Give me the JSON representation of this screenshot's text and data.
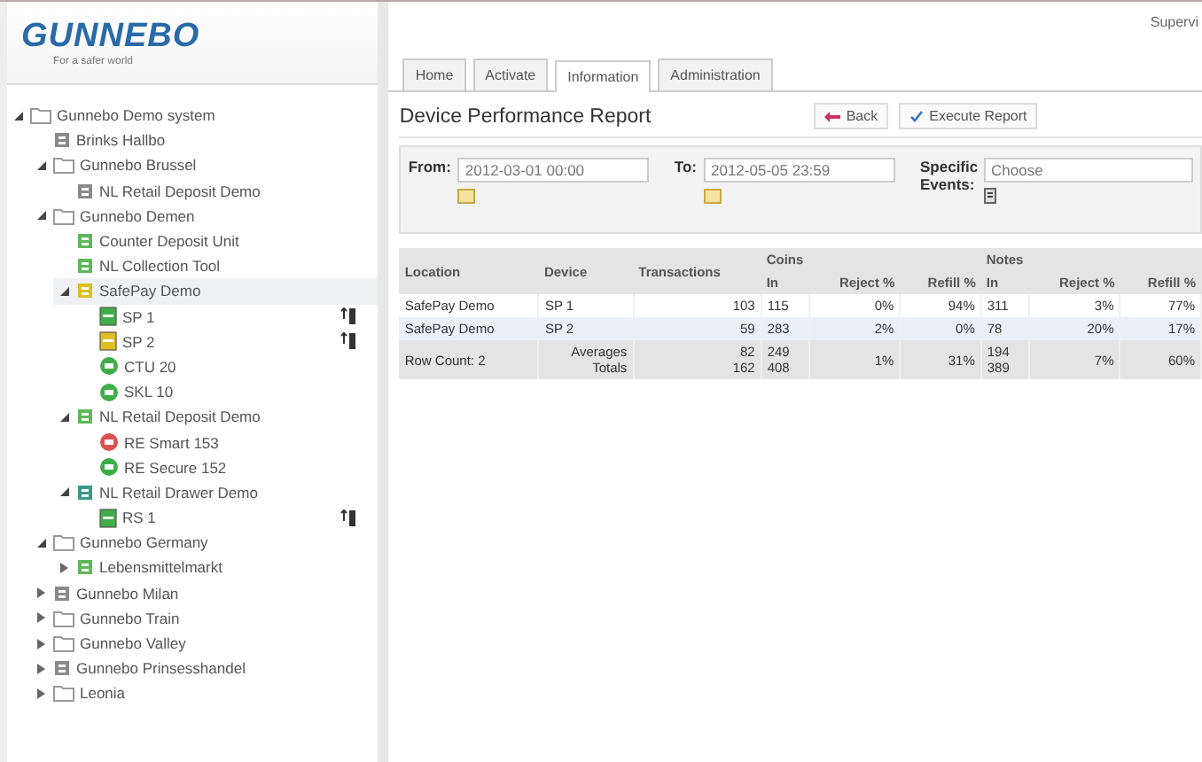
{
  "logo": {
    "name": "GUNNEBO",
    "tagline": "For a safer world"
  },
  "user": "Supervi",
  "tree": [
    {
      "label": "Gunnebo Demo system",
      "kind": "folder",
      "color": "#9a9a9a",
      "expanded": true,
      "selected": false,
      "children": [
        {
          "label": "Brinks Hallbo",
          "kind": "site",
          "color": "#8a8a8a",
          "selected": false
        },
        {
          "label": "Gunnebo Brussel",
          "kind": "folder",
          "color": "#9a9a9a",
          "expanded": true,
          "selected": false,
          "children": [
            {
              "label": "NL Retail Deposit Demo",
              "kind": "site",
              "color": "#8a8a8a",
              "selected": false
            }
          ]
        },
        {
          "label": "Gunnebo Demen",
          "kind": "folder",
          "color": "#9a9a9a",
          "expanded": true,
          "selected": false,
          "children": [
            {
              "label": "Counter Deposit Unit",
              "kind": "site",
              "color": "#5fb85a",
              "selected": false
            },
            {
              "label": "NL Collection Tool",
              "kind": "site",
              "color": "#5fb85a",
              "selected": false
            },
            {
              "label": "SafePay Demo",
              "kind": "site",
              "color": "#d8c21c",
              "expanded": true,
              "selected": true,
              "children": [
                {
                  "label": "SP 1",
                  "kind": "device",
                  "color": "#3fae49",
                  "selected": false,
                  "alert": true
                },
                {
                  "label": "SP 2",
                  "kind": "device",
                  "color": "#e0c020",
                  "selected": false,
                  "alert": true
                },
                {
                  "label": "CTU 20",
                  "kind": "round",
                  "color": "#3fae49",
                  "selected": false,
                  "alert": false
                },
                {
                  "label": "SKL 10",
                  "kind": "round",
                  "color": "#3fae49",
                  "selected": false,
                  "alert": false
                }
              ]
            },
            {
              "label": "NL Retail Deposit Demo",
              "kind": "site",
              "color": "#5fb85a",
              "expanded": true,
              "selected": false,
              "children": [
                {
                  "label": "RE Smart 153",
                  "kind": "round",
                  "color": "#d9534f",
                  "selected": false,
                  "alert": false
                },
                {
                  "label": "RE Secure 152",
                  "kind": "round",
                  "color": "#3fae49",
                  "selected": false,
                  "alert": false
                }
              ]
            },
            {
              "label": "NL Retail Drawer Demo",
              "kind": "site",
              "color": "#3a9a8a",
              "expanded": true,
              "selected": false,
              "children": [
                {
                  "label": "RS 1",
                  "kind": "device",
                  "color": "#3fae49",
                  "selected": false,
                  "alert": true
                }
              ]
            }
          ]
        },
        {
          "label": "Gunnebo Germany",
          "kind": "folder",
          "color": "#9a9a9a",
          "expanded": true,
          "selected": false,
          "children": [
            {
              "label": "Lebensmittelmarkt",
              "kind": "site",
              "color": "#5fb85a",
              "expanded": false,
              "selected": false
            }
          ]
        },
        {
          "label": "Gunnebo Milan",
          "kind": "site",
          "color": "#8a8a8a",
          "expanded": false,
          "selected": false
        },
        {
          "label": "Gunnebo Train",
          "kind": "folder",
          "color": "#9a9a9a",
          "expanded": false,
          "selected": false
        },
        {
          "label": "Gunnebo Valley",
          "kind": "folder",
          "color": "#9a9a9a",
          "expanded": false,
          "selected": false
        },
        {
          "label": "Gunnebo Prinsesshandel",
          "kind": "site",
          "color": "#8a8a8a",
          "expanded": false,
          "selected": false
        },
        {
          "label": "Leonia",
          "kind": "folder",
          "color": "#9a9a9a",
          "expanded": false,
          "selected": false
        }
      ]
    }
  ],
  "tabs": [
    {
      "label": "Home",
      "selected": false
    },
    {
      "label": "Activate",
      "selected": false
    },
    {
      "label": "Information",
      "selected": true
    },
    {
      "label": "Administration",
      "selected": false
    }
  ],
  "report": {
    "title": "Device Performance Report",
    "back": "Back",
    "execute": "Execute Report"
  },
  "filters": {
    "from_label": "From:",
    "from": "2012-03-01 00:00",
    "to_label": "To:",
    "to": "2012-05-05 23:59",
    "events_label": "Specific Events:",
    "events": "Choose"
  },
  "table": {
    "columns": [
      "Location",
      "Device",
      "Transactions"
    ],
    "groups": [
      "Coins",
      "Notes"
    ],
    "subcolumns": [
      "In",
      "Reject %",
      "Refill %",
      "In",
      "Reject %",
      "Refill %"
    ],
    "rows": [
      [
        "SafePay Demo",
        "SP 1",
        "103",
        "115",
        "0%",
        "94%",
        "311",
        "3%",
        "77%"
      ],
      [
        "SafePay Demo",
        "SP 2",
        "59",
        "283",
        "2%",
        "0%",
        "78",
        "20%",
        "17%"
      ]
    ],
    "footer": [
      "Row Count: 2",
      "Averages\nTotals",
      "82\n162",
      "249\n408",
      "1%",
      "31%",
      "194\n389",
      "7%",
      "60%"
    ]
  }
}
